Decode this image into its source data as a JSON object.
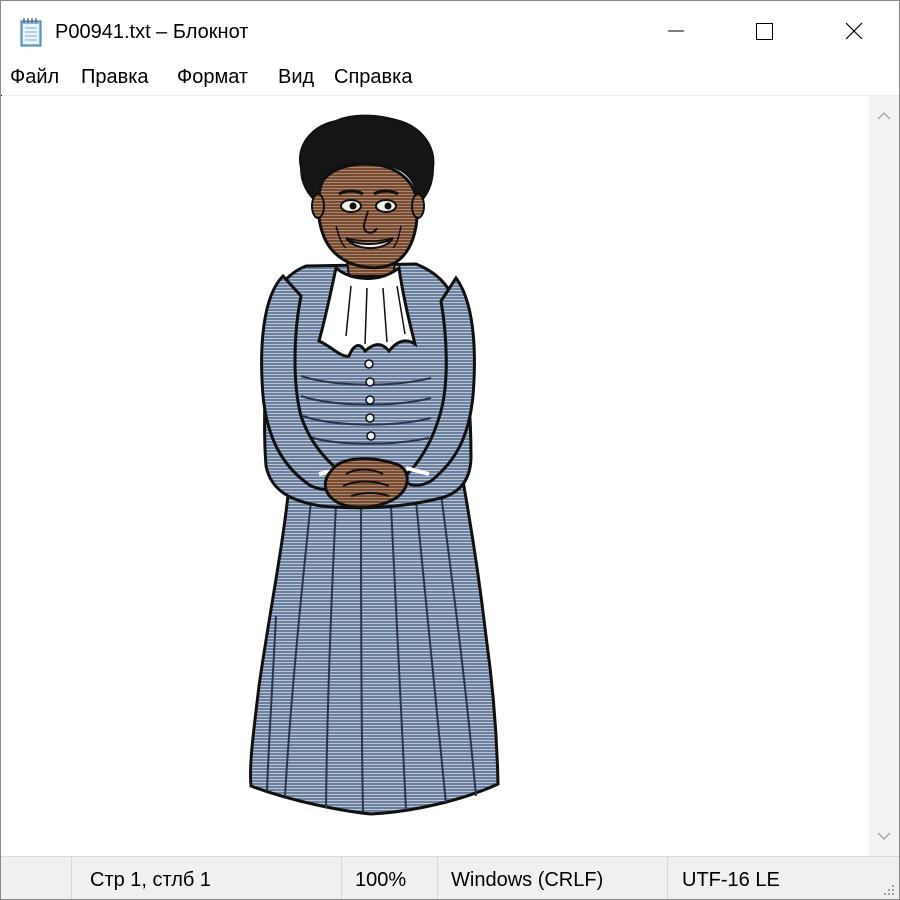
{
  "window": {
    "title": "P00941.txt – Блокнот",
    "icons": {
      "app": "notepad-icon",
      "minimize": "minimize-icon",
      "maximize": "maximize-icon",
      "close": "close-icon"
    }
  },
  "menu": {
    "items": [
      {
        "label": "Файл"
      },
      {
        "label": "Правка"
      },
      {
        "label": "Формат"
      },
      {
        "label": "Вид"
      },
      {
        "label": "Справка"
      }
    ]
  },
  "editor": {
    "content": "ascii-art-woman-in-blue-dress",
    "colors": {
      "dress": "#6b7f9f",
      "dress_shadow": "#4e5f7d",
      "skin": "#7a4a2e",
      "hair": "#151515",
      "collar": "#ffffff",
      "outline": "#101010"
    }
  },
  "scrollbar": {
    "up_icon": "chevron-up-icon",
    "down_icon": "chevron-down-icon"
  },
  "status": {
    "position": "Стр 1, стлб 1",
    "zoom": "100%",
    "line_endings": "Windows (CRLF)",
    "encoding": "UTF-16 LE"
  }
}
